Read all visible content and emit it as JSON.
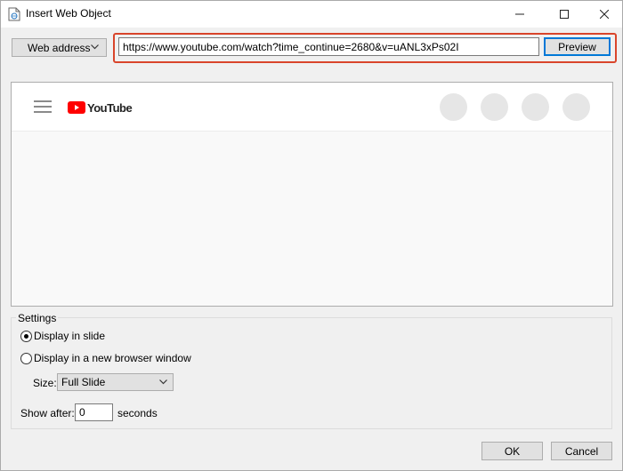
{
  "window": {
    "title": "Insert Web Object"
  },
  "toolbar": {
    "address_type": "Web address",
    "url_value": "https://www.youtube.com/watch?time_continue=2680&v=uANL3xPs02I",
    "preview_label": "Preview"
  },
  "preview": {
    "logo_text": "YouTube"
  },
  "settings": {
    "legend": "Settings",
    "options": [
      {
        "label": "Display in slide",
        "checked": true
      },
      {
        "label": "Display in a new browser window",
        "checked": false
      }
    ],
    "size_label": "Size:",
    "size_value": "Full Slide",
    "show_after_label": "Show after:",
    "show_after_value": "0",
    "seconds_label": "seconds"
  },
  "footer": {
    "ok_label": "OK",
    "cancel_label": "Cancel"
  },
  "colors": {
    "highlight": "#d9452b",
    "accent": "#0078d7",
    "youtube_red": "#ff0000"
  }
}
